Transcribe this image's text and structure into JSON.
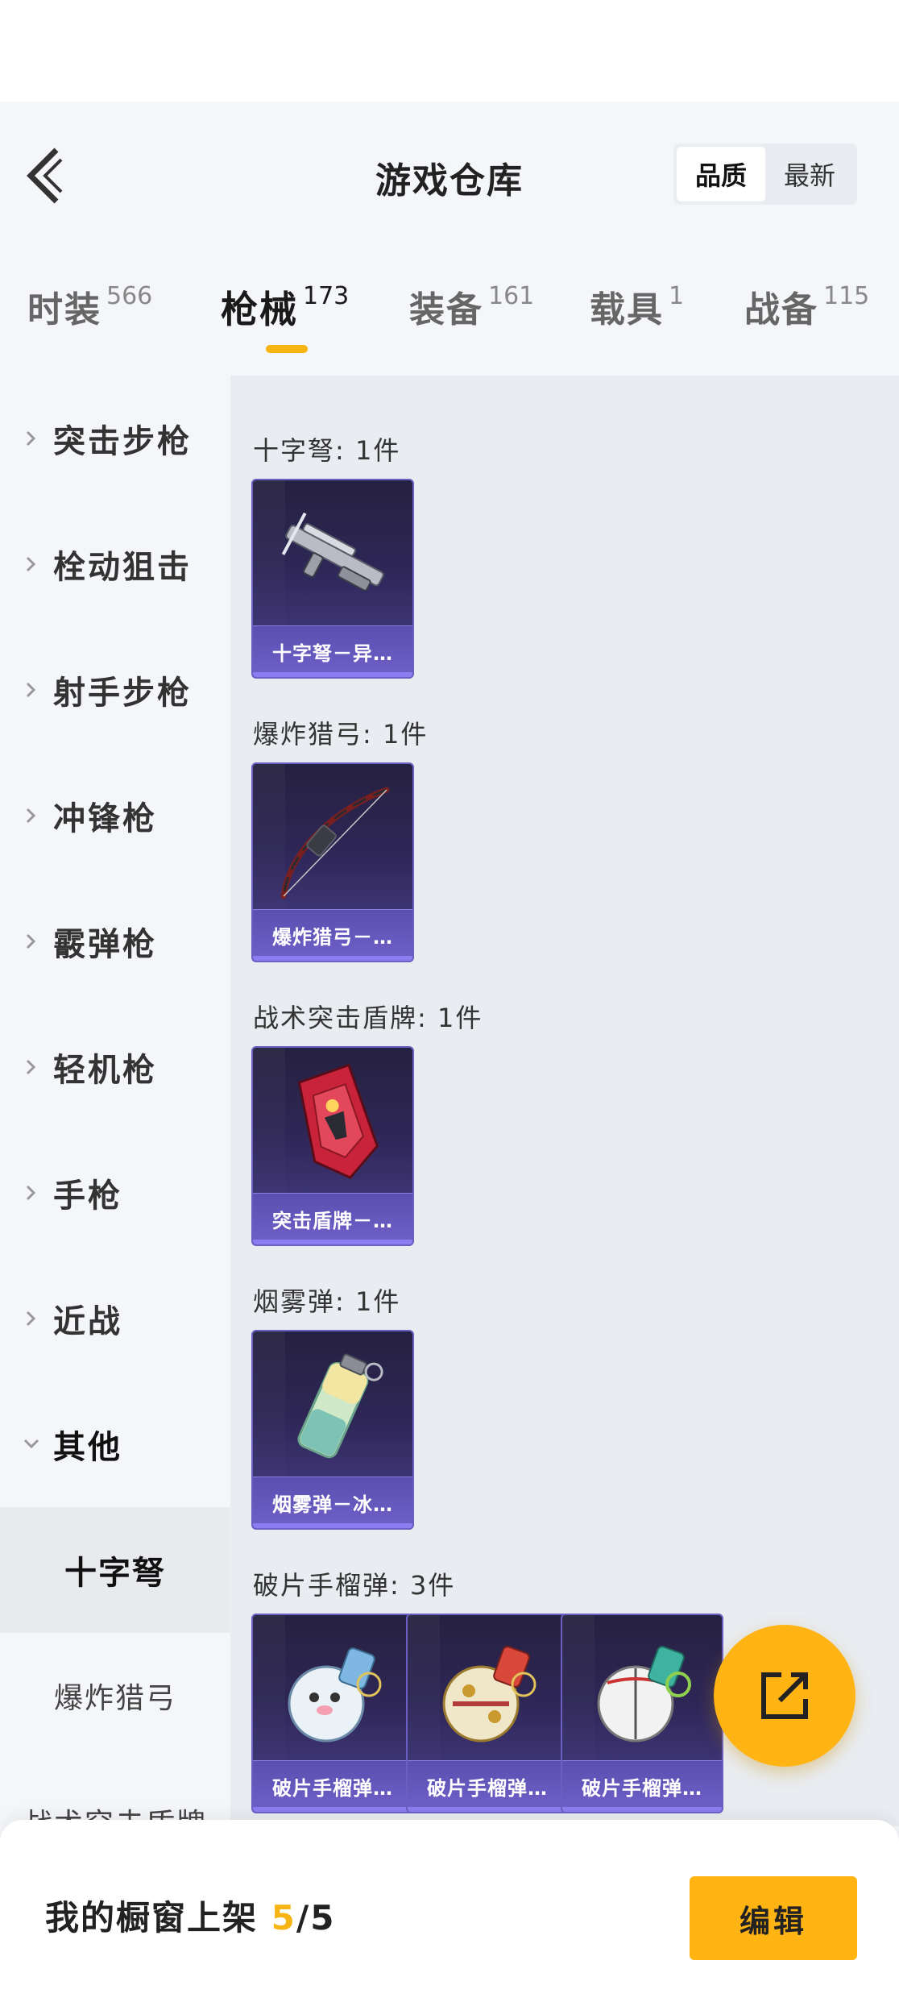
{
  "header": {
    "title": "游戏仓库",
    "sort_options": [
      "品质",
      "最新"
    ],
    "active_sort": "品质"
  },
  "tabs": [
    {
      "label": "时装",
      "count": "566"
    },
    {
      "label": "枪械",
      "count": "173",
      "active": true
    },
    {
      "label": "装备",
      "count": "161"
    },
    {
      "label": "载具",
      "count": "1"
    },
    {
      "label": "战备",
      "count": "115"
    }
  ],
  "sidebar": {
    "items": [
      "突击步枪",
      "栓动狙击",
      "射手步枪",
      "冲锋枪",
      "霰弹枪",
      "轻机枪",
      "手枪",
      "近战",
      "其他"
    ],
    "sub_items": [
      "十字弩",
      "爆炸猎弓",
      "战术突击盾牌"
    ],
    "active_sub": "十字弩"
  },
  "sections": [
    {
      "title": "十字弩: 1件",
      "items": [
        {
          "name": "十字弩－异…",
          "icon": "crossbow-icon"
        }
      ]
    },
    {
      "title": "爆炸猎弓: 1件",
      "items": [
        {
          "name": "爆炸猎弓－…",
          "icon": "bow-icon"
        }
      ]
    },
    {
      "title": "战术突击盾牌: 1件",
      "items": [
        {
          "name": "突击盾牌－…",
          "icon": "shield-icon"
        }
      ]
    },
    {
      "title": "烟雾弹: 1件",
      "items": [
        {
          "name": "烟雾弹－冰…",
          "icon": "smoke-grenade-icon"
        }
      ]
    },
    {
      "title": "破片手榴弹: 3件",
      "items": [
        {
          "name": "破片手榴弹…",
          "icon": "grenade-icon"
        },
        {
          "name": "破片手榴弹…",
          "icon": "grenade-icon"
        },
        {
          "name": "破片手榴弹…",
          "icon": "grenade-icon"
        }
      ]
    }
  ],
  "footer": {
    "shelf_label": "我的橱窗上架",
    "shelf_current": "5",
    "shelf_total": "/5",
    "edit_label": "编辑"
  },
  "colors": {
    "accent": "#ffb414",
    "card_bg": "#2e2757",
    "card_name_bar": "#6f60c8"
  }
}
